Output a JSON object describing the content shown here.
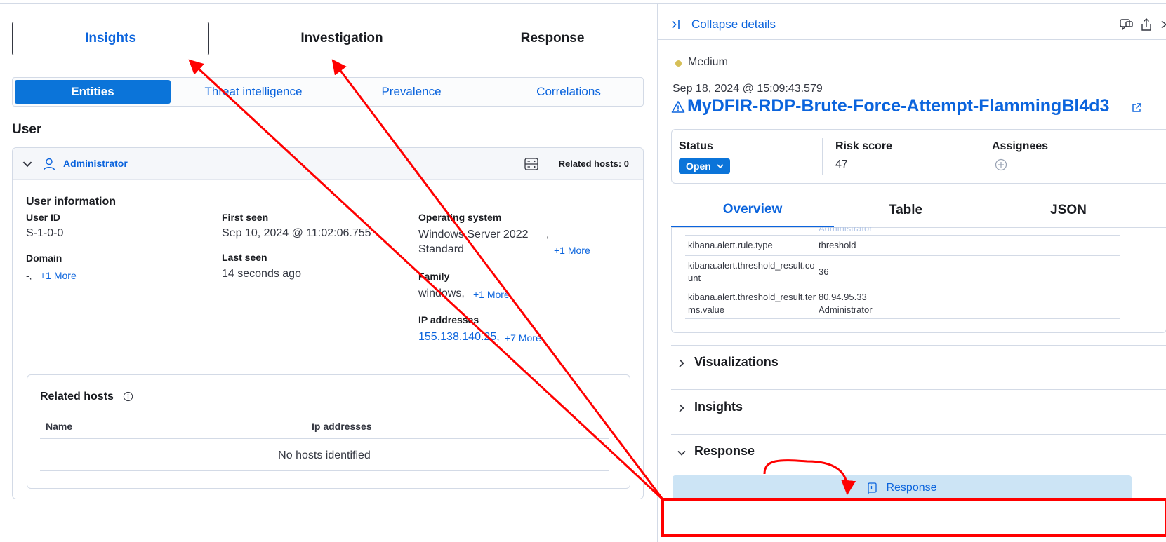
{
  "main_tabs": [
    "Insights",
    "Investigation",
    "Response"
  ],
  "sub_tabs": [
    "Entities",
    "Threat intelligence",
    "Prevalence",
    "Correlations"
  ],
  "user_section": {
    "heading": "User",
    "user_name": "Administrator",
    "related_hosts_count": "Related hosts: 0",
    "info_title": "User information",
    "fields": {
      "user_id_label": "User ID",
      "user_id_value": "S-1-0-0",
      "domain_label": "Domain",
      "domain_value": "-,",
      "domain_more": "+1 More",
      "first_seen_label": "First seen",
      "first_seen_value": "Sep 10, 2024 @ 11:02:06.755",
      "last_seen_label": "Last seen",
      "last_seen_value": "14 seconds ago",
      "os_label": "Operating system",
      "os_value_1": "Windows Server 2022",
      "os_value_2": "Standard",
      "os_sep": ",",
      "os_more": "+1 More",
      "family_label": "Family",
      "family_value": "windows,",
      "family_more": "+1 More",
      "ip_label": "IP addresses",
      "ip_value": "155.138.140.25,",
      "ip_more": "+7 More"
    },
    "related_hosts": {
      "title": "Related hosts",
      "columns": [
        "Name",
        "Ip addresses"
      ],
      "empty": "No hosts identified"
    }
  },
  "details": {
    "collapse": "Collapse details",
    "severity": "Medium",
    "timestamp": "Sep 18, 2024 @ 15:09:43.579",
    "rule_name": "MyDFIR-RDP-Brute-Force-Attempt-FlammingBl4d3",
    "status_label": "Status",
    "status_value": "Open",
    "risk_label": "Risk score",
    "risk_value": "47",
    "assignees_label": "Assignees",
    "tabs": [
      "Overview",
      "Table",
      "JSON"
    ],
    "ghost_value": "Administrator",
    "rows": [
      {
        "key": "kibana.alert.rule.type",
        "value_1": "threshold",
        "value_2": ""
      },
      {
        "key": "kibana.alert.threshold_result.count",
        "value_1": "36",
        "value_2": ""
      },
      {
        "key": "kibana.alert.threshold_result.terms.value",
        "value_1": "80.94.95.33",
        "value_2": "Administrator"
      }
    ],
    "sections": [
      "Visualizations",
      "Insights",
      "Response"
    ],
    "response_button": "Response"
  },
  "colors": {
    "accent": "#0b64dd",
    "primary": "#0b74d9",
    "severity_medium": "#d6bf57",
    "annotation": "#ff0000"
  },
  "icons": [
    "chevron-down-icon",
    "user-icon",
    "hosts-icon",
    "info-icon",
    "collapse-icon",
    "chat-icon",
    "share-icon",
    "close-icon",
    "warning-icon",
    "external-link-icon",
    "plus-circle-icon",
    "chevron-right-icon",
    "response-icon"
  ]
}
